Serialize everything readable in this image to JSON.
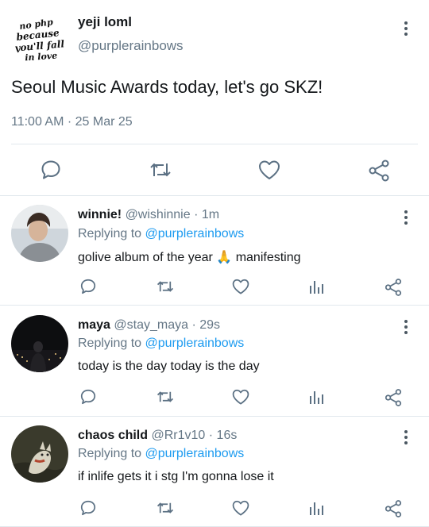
{
  "main_tweet": {
    "avatar_text": [
      "no php",
      "because",
      "you'll fall",
      "in love"
    ],
    "name": "yeji loml",
    "handle": "@purplerainbows",
    "text": "Seoul Music Awards today, let's go SKZ!",
    "timestamp": "11:00 AM · 25 Mar 25",
    "more_icon": "more-vertical-icon",
    "actions": [
      "reply-icon",
      "retweet-icon",
      "like-icon",
      "share-icon"
    ]
  },
  "replies": [
    {
      "name": "winnie!",
      "handle": "@wishinnie",
      "time": "· 1m",
      "replying_label": "Replying to",
      "replying_to": "@purplerainbows",
      "text": "golive album of the year 🙏 manifesting"
    },
    {
      "name": "maya",
      "handle": "@stay_maya",
      "time": "· 29s",
      "replying_label": "Replying to",
      "replying_to": "@purplerainbows",
      "text": "today is the day today is the day"
    },
    {
      "name": "chaos child",
      "handle": "@Rr1v10",
      "time": "· 16s",
      "replying_label": "Replying to",
      "replying_to": "@purplerainbows",
      "text": "if inlife gets it i stg I'm gonna lose it"
    }
  ],
  "reply_actions": [
    "reply-icon",
    "retweet-icon",
    "like-icon",
    "analytics-icon",
    "share-icon"
  ],
  "colors": {
    "link": "#1d9bf0",
    "muted": "#657786",
    "icon": "#5b7083",
    "divider": "#e1e8ed"
  }
}
